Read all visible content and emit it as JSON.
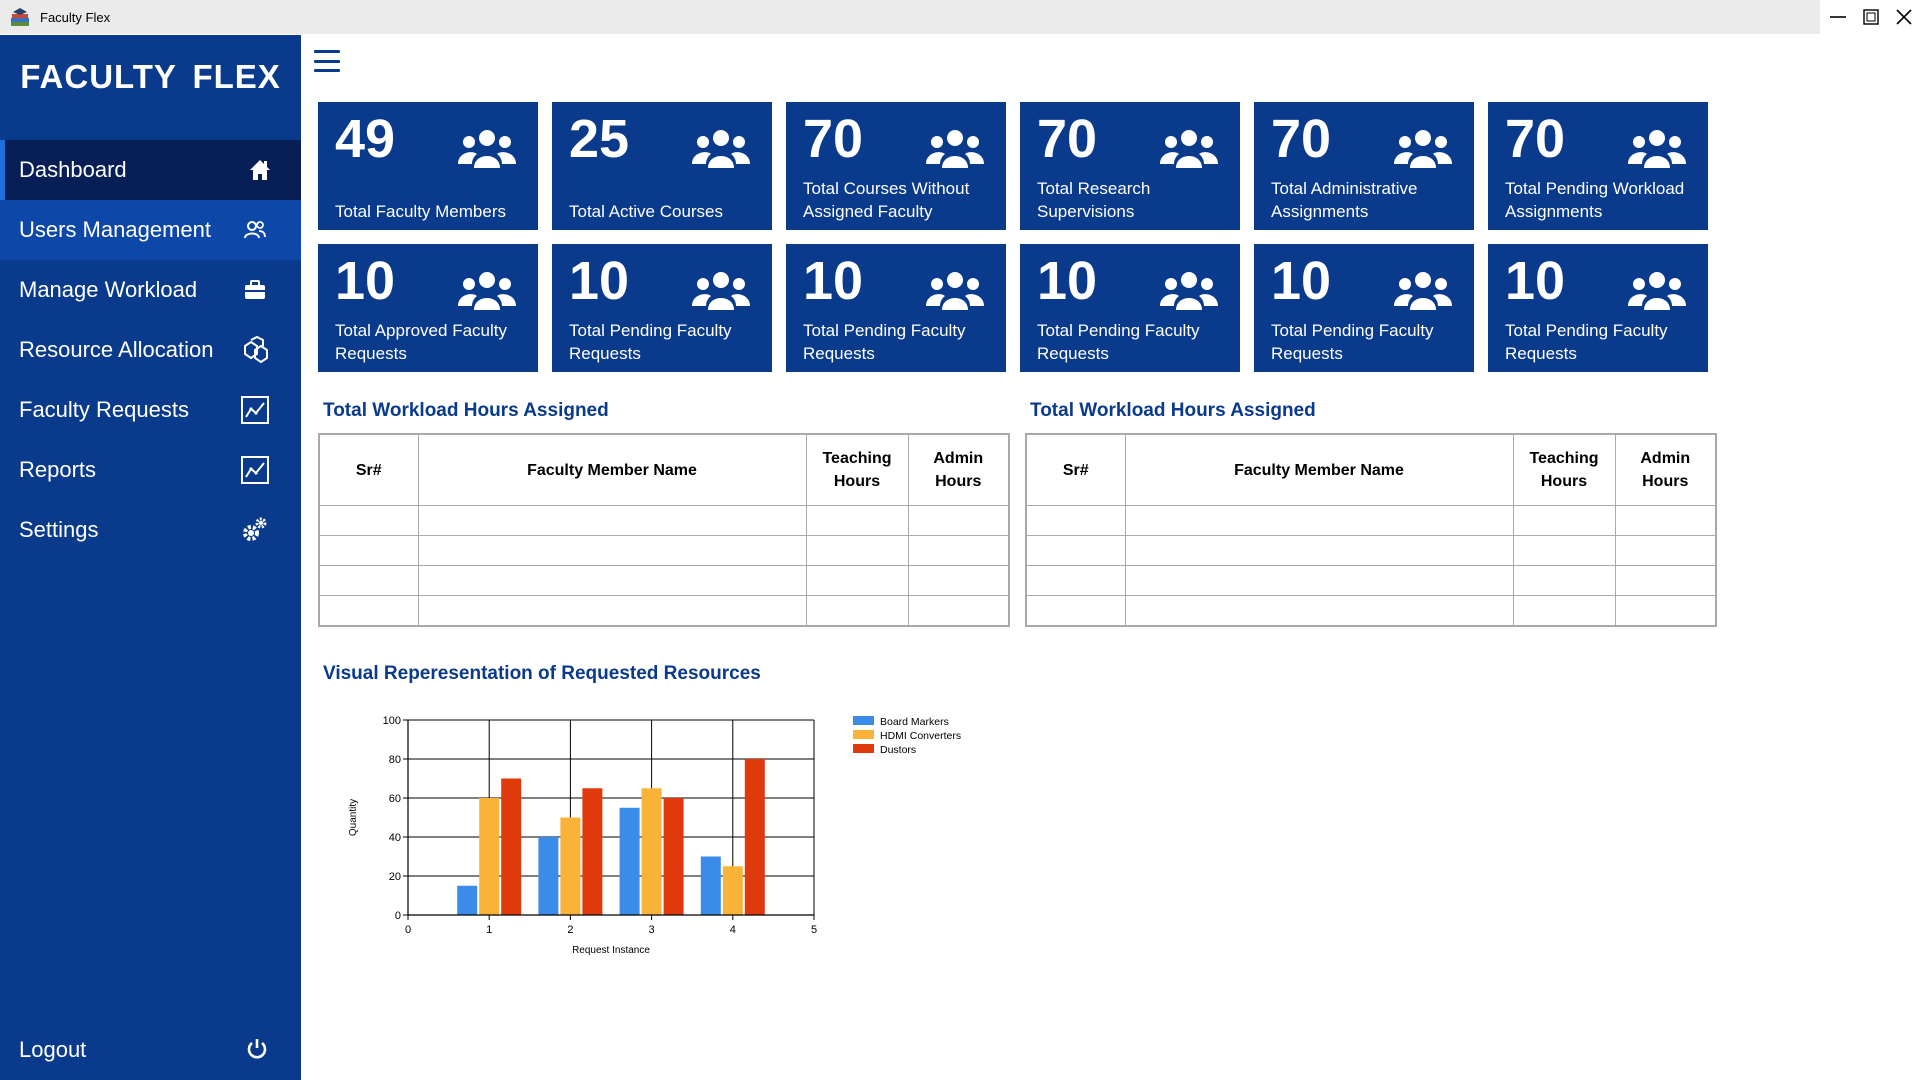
{
  "window": {
    "title": "Faculty Flex"
  },
  "sidebar": {
    "brand": "FACULTY  FLEX",
    "items": [
      {
        "label": "Dashboard",
        "icon": "home-icon"
      },
      {
        "label": "Users Management",
        "icon": "users-icon"
      },
      {
        "label": "Manage Workload",
        "icon": "briefcase-icon"
      },
      {
        "label": "Resource Allocation",
        "icon": "boxes-icon"
      },
      {
        "label": "Faculty Requests",
        "icon": "chart-icon"
      },
      {
        "label": "Reports",
        "icon": "chart-icon"
      },
      {
        "label": "Settings",
        "icon": "gears-icon"
      }
    ],
    "logout": "Logout"
  },
  "cards": [
    {
      "number": "49",
      "label": "Total Faculty Members"
    },
    {
      "number": "25",
      "label": "Total Active Courses"
    },
    {
      "number": "70",
      "label": "Total Courses Without Assigned Faculty"
    },
    {
      "number": "70",
      "label": "Total Research Supervisions"
    },
    {
      "number": "70",
      "label": "Total Administrative Assignments"
    },
    {
      "number": "70",
      "label": "Total Pending Workload Assignments"
    },
    {
      "number": "10",
      "label": "Total Approved Faculty Requests"
    },
    {
      "number": "10",
      "label": "Total Pending Faculty Requests"
    },
    {
      "number": "10",
      "label": "Total Pending Faculty Requests"
    },
    {
      "number": "10",
      "label": "Total Pending Faculty Requests"
    },
    {
      "number": "10",
      "label": "Total Pending Faculty Requests"
    },
    {
      "number": "10",
      "label": "Total Pending Faculty Requests"
    }
  ],
  "tables": [
    {
      "title": "Total Workload Hours Assigned",
      "headers": [
        "Sr#",
        "Faculty Member Name",
        "Teaching Hours",
        "Admin Hours"
      ]
    },
    {
      "title": "Total Workload Hours Assigned",
      "headers": [
        "Sr#",
        "Faculty Member Name",
        "Teaching Hours",
        "Admin Hours"
      ]
    }
  ],
  "chart_section": {
    "title": "Visual Reperesentation of Requested Resources"
  },
  "chart_data": {
    "type": "bar",
    "x": [
      1,
      2,
      3,
      4
    ],
    "xlabel": "Request Instance",
    "ylabel": "Quantity",
    "xlim": [
      0,
      5
    ],
    "ylim": [
      0,
      100
    ],
    "xticks": [
      0,
      1,
      2,
      3,
      4,
      5
    ],
    "yticks": [
      0,
      20,
      40,
      60,
      80,
      100
    ],
    "grid": true,
    "legend": "top-right",
    "series": [
      {
        "name": "Board Markers",
        "color": "#3b8be8",
        "values": [
          15,
          40,
          55,
          30
        ]
      },
      {
        "name": "HDMI Converters",
        "color": "#f9b339",
        "values": [
          60,
          50,
          65,
          25
        ]
      },
      {
        "name": "Dustors",
        "color": "#e0390b",
        "values": [
          70,
          65,
          60,
          80
        ]
      }
    ]
  },
  "colors": {
    "primary": "#0a3a8c",
    "active_nav": "#071f55",
    "accent": "#1e6fd9"
  }
}
